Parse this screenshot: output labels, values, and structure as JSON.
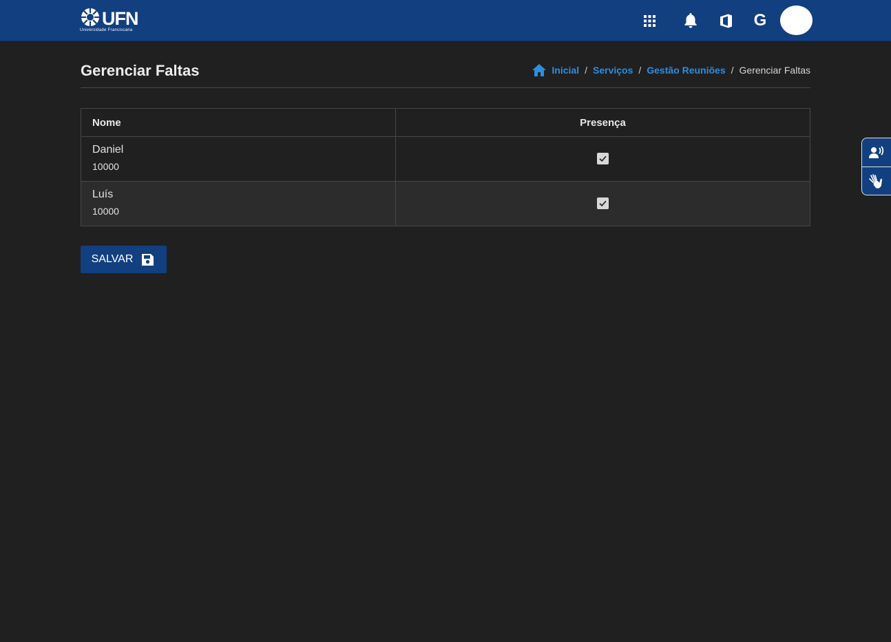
{
  "header": {
    "logo_text": "UFN",
    "logo_subtitle": "Universidade Franciscana",
    "icons": [
      "apps-grid-icon",
      "notification-bell-icon",
      "office-icon",
      "google-icon",
      "user-avatar"
    ],
    "google_letter": "G",
    "accent_color": "#123f80"
  },
  "page": {
    "title": "Gerenciar Faltas"
  },
  "breadcrumb": {
    "items": [
      "Inicial",
      "Serviços",
      "Gestão Reuniões"
    ],
    "current": "Gerenciar Faltas",
    "separator": "/"
  },
  "table": {
    "columns": [
      "Nome",
      "Presença"
    ],
    "rows": [
      {
        "nome": "Daniel",
        "matricula": "10000",
        "presente": true
      },
      {
        "nome": "Luís",
        "matricula": "10000",
        "presente": true
      }
    ]
  },
  "actions": {
    "save_label": "SALVAR"
  },
  "accessibility": {
    "buttons": [
      "audio-description-icon",
      "sign-language-icon"
    ]
  }
}
